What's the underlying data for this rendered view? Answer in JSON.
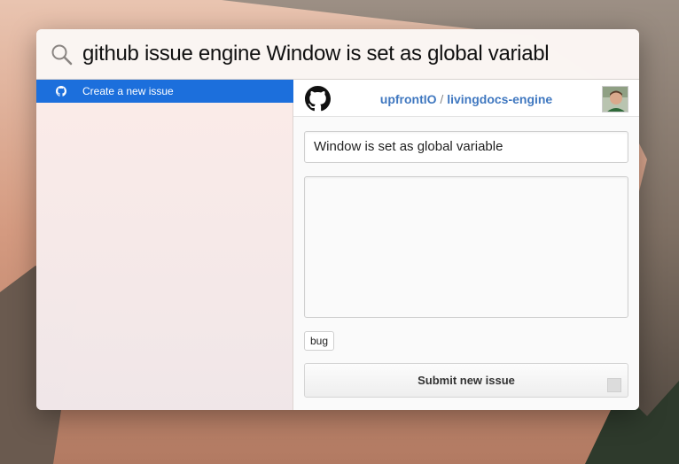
{
  "search": {
    "query": "github issue engine Window is set as global variabl",
    "icon": "search-icon"
  },
  "results": {
    "items": [
      {
        "label": "Create a new issue",
        "icon": "github-icon",
        "selected": true
      }
    ]
  },
  "preview": {
    "repo_owner": "upfrontIO",
    "repo_separator": "/",
    "repo_name": "livingdocs-engine",
    "title_value": "Window is set as global variable",
    "body_value": "",
    "labels": [
      "bug"
    ],
    "submit_label": "Submit new issue"
  },
  "colors": {
    "selection": "#1c6fdc",
    "link": "#4078c0"
  }
}
